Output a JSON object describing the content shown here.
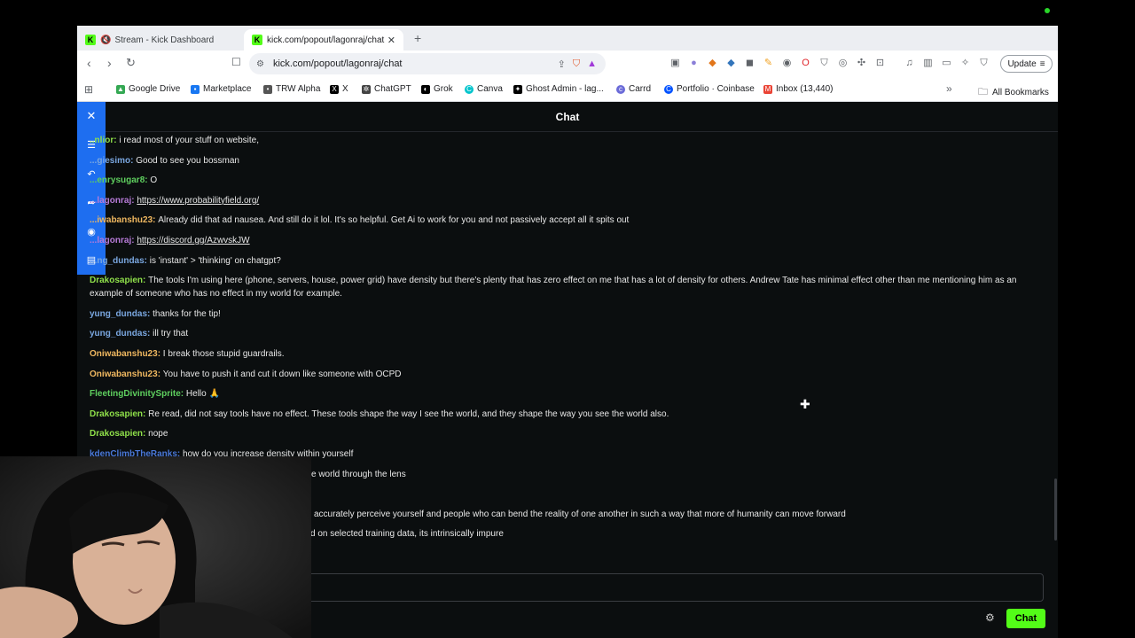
{
  "browser": {
    "tabs": [
      {
        "title": "Stream - Kick Dashboard",
        "muted": true
      },
      {
        "title": "kick.com/popout/lagonraj/chat",
        "active": true
      }
    ],
    "url": "kick.com/popout/lagonraj/chat",
    "update_label": "Update",
    "extension_badge": "1"
  },
  "bookmarks": {
    "items": [
      {
        "label": "Google Drive"
      },
      {
        "label": "Marketplace"
      },
      {
        "label": "TRW Alpha"
      },
      {
        "label": "X"
      },
      {
        "label": "ChatGPT"
      },
      {
        "label": "Grok"
      },
      {
        "label": "Canva"
      },
      {
        "label": "Ghost Admin - lag..."
      },
      {
        "label": "Carrd"
      },
      {
        "label": "Portfolio · Coinbase"
      },
      {
        "label": "Inbox (13,440)"
      }
    ],
    "all_label": "All Bookmarks"
  },
  "chat": {
    "title": "Chat",
    "messages": [
      {
        "user": "..nlior",
        "text": "i read most of your stuff on website,"
      },
      {
        "user": "...giesimo",
        "text": "Good to see you bossman"
      },
      {
        "user": "...enrysugar8",
        "text": "O"
      },
      {
        "user": "...lagonraj",
        "text": "https://www.probabilityfield.org/"
      },
      {
        "user": "...iwabanshu23",
        "text": "Already did that ad nausea. And still do it lol. It's so helpful. Get Ai to work for you and not passively accept all it spits out"
      },
      {
        "user": "...lagonraj",
        "text": "https://discord.gg/AzwvskJW"
      },
      {
        "user": "...ng_dundas",
        "text": "is 'instant' > 'thinking' on chatgpt?"
      },
      {
        "user": "Drakosapien",
        "text": "The tools I'm using here (phone, servers, house, power grid) have density but there's plenty that has zero effect on me that has a lot of density for others. Andrew Tate has minimal effect other than me mentioning him as an example of someone who has no effect in my world for example."
      },
      {
        "user": "yung_dundas",
        "text": "thanks for the tip!"
      },
      {
        "user": "yung_dundas",
        "text": "ill try that"
      },
      {
        "user": "Oniwabanshu23",
        "text": "I break those stupid guardrails."
      },
      {
        "user": "Oniwabanshu23",
        "text": "You have to push it and cut it down like someone with OCPD"
      },
      {
        "user": "FleetingDivinitySprite",
        "text": "Hello 🙏"
      },
      {
        "user": "Drakosapien",
        "text": "Re read, did not say tools have no effect. These tools shape the way I see the world, and they shape the way you see the world also."
      },
      {
        "user": "Drakosapien",
        "text": "nope"
      },
      {
        "user": "kdenClimbTheRanks",
        "text": "how do you increase density within yourself"
      },
      {
        "user": "",
        "text": "e world through the lens"
      },
      {
        "user": "",
        "text": "accurately perceive yourself and people who can bend the reality of one another in such a way that more of humanity can move forward"
      },
      {
        "user": "",
        "text": "d on selected training data, its intrinsically impure"
      }
    ],
    "send_label": "Chat",
    "input_placeholder": ""
  },
  "colors": {
    "accent": "#53fc18",
    "side_controls": "#1e6ef0",
    "chat_bg": "#0b0e0f"
  }
}
